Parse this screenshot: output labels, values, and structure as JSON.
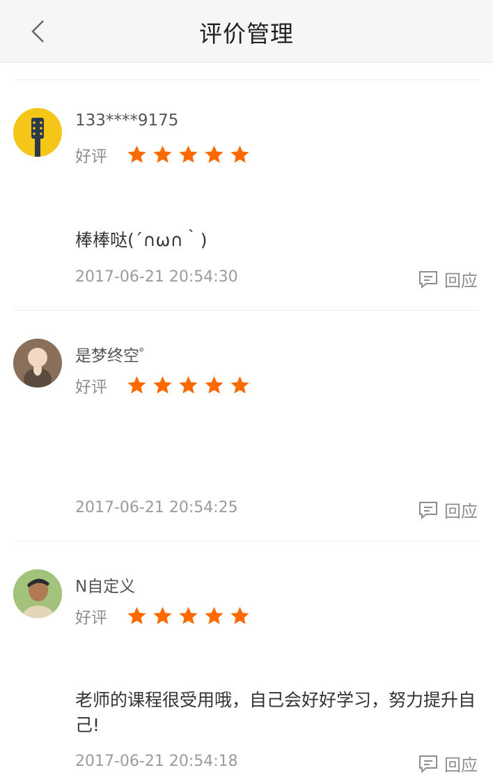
{
  "header": {
    "title": "评价管理",
    "back_icon": "chevron-left-icon"
  },
  "colors": {
    "star": "#ff6a00",
    "accent": "#ff6a00"
  },
  "reviews": [
    {
      "nickname": "133****9175",
      "grade": "好评",
      "rating": 5,
      "comment": "棒棒哒(´∩ω∩｀)",
      "time": "2017-06-21 20:54:30",
      "reply_label": "回应",
      "avatar": "guitar-avatar"
    },
    {
      "nickname": "是梦终空゜",
      "grade": "好评",
      "rating": 5,
      "comment": "",
      "time": "2017-06-21 20:54:25",
      "reply_label": "回应",
      "avatar": "photo-avatar"
    },
    {
      "nickname": "N自定义",
      "grade": "好评",
      "rating": 5,
      "comment": "老师的课程很受用哦，自己会好好学习，努力提升自己!",
      "time": "2017-06-21 20:54:18",
      "reply_label": "回应",
      "avatar": "photo-avatar"
    }
  ]
}
